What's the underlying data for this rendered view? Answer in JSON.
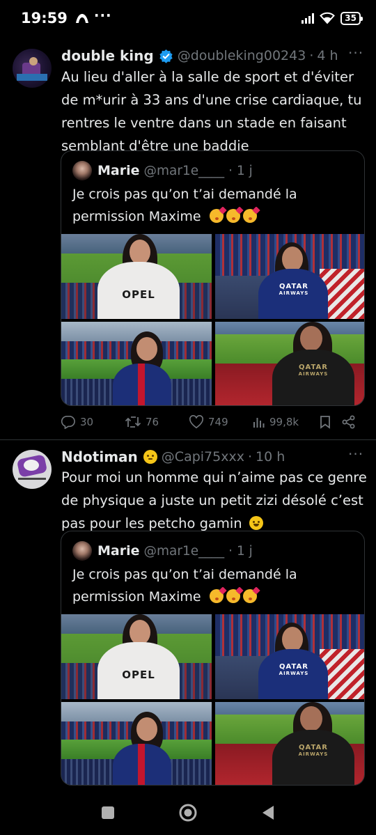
{
  "status_bar": {
    "time": "19:59",
    "overflow": "···",
    "battery": "35"
  },
  "tweets": [
    {
      "name": "double king",
      "handle": "@doubleking00243",
      "separator": "·",
      "time": "4 h",
      "text": "Au lieu d'aller à la salle de sport et d'éviter de m*urir à 33 ans d'une crise cardiaque, tu rentres le ventre dans un stade en faisant semblant d'être une baddie",
      "quote": {
        "name": "Marie",
        "handle": "@mar1e____",
        "separator": "·",
        "time": "1 j",
        "text": "Je crois pas qu’on t’ai demandé la permission Maxime"
      },
      "stats": {
        "replies": "30",
        "reposts": "76",
        "likes": "749",
        "views": "99,8k"
      }
    },
    {
      "name": "Ndotiman",
      "handle": "@Capi75xxx",
      "separator": "·",
      "time": "10 h",
      "text": "Pour moi un homme qui n’aime pas ce genre de physique a juste un petit zizi désolé c’est pas pour les petcho gamin",
      "quote": {
        "name": "Marie",
        "handle": "@mar1e____",
        "separator": "·",
        "time": "1 j",
        "text": "Je crois pas qu’on t’ai demandé la permission Maxime"
      }
    }
  ],
  "photo_labels": {
    "opel": "OPEL",
    "qatar": "QATAR",
    "airways": "AIRWAYS"
  },
  "icons": [
    "verified-badge-icon",
    "more-icon",
    "reply-icon",
    "repost-icon",
    "like-icon",
    "views-icon",
    "bookmark-icon",
    "share-icon",
    "laughing-emoji-icon",
    "neutral-emoji-icon",
    "kiss-emoji-icon",
    "wifi-icon",
    "signal-icon",
    "battery-icon",
    "nav-recents-icon",
    "nav-home-icon",
    "nav-back-icon"
  ],
  "colors": {
    "background": "#000000",
    "text": "#e7e9ea",
    "muted": "#71767b",
    "border": "#2f3336",
    "verified": "#1d9bf0"
  }
}
